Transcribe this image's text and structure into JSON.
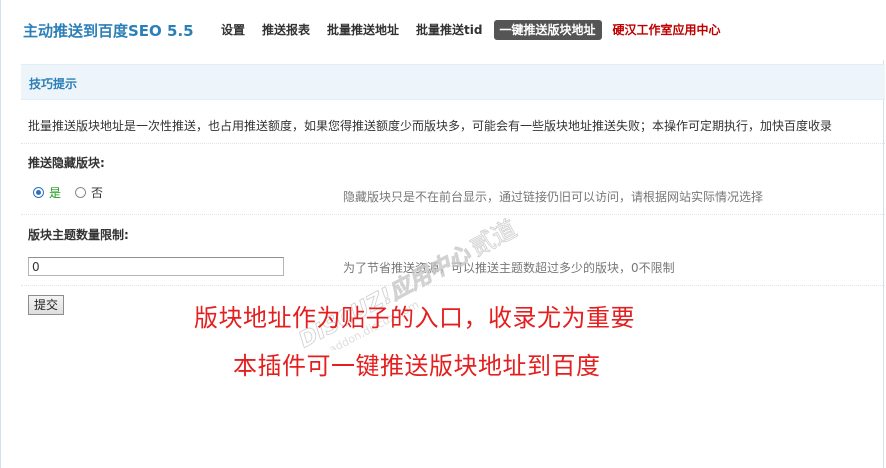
{
  "header": {
    "app_title": "主动推送到百度SEO 5.5",
    "nav": [
      {
        "label": "设置",
        "active": false,
        "external": false
      },
      {
        "label": "推送报表",
        "active": false,
        "external": false
      },
      {
        "label": "批量推送地址",
        "active": false,
        "external": false
      },
      {
        "label": "批量推送tid",
        "active": false,
        "external": false
      },
      {
        "label": "一键推送版块地址",
        "active": true,
        "external": false
      },
      {
        "label": "硬汉工作室应用中心",
        "active": false,
        "external": true
      }
    ]
  },
  "tip": {
    "title": "技巧提示",
    "text": "批量推送版块地址是一次性推送，也占用推送额度，如果您得推送额度少而版块多，可能会有一些版块地址推送失败；本操作可定期执行，加快百度收录"
  },
  "options": {
    "hidden_forums": {
      "label": "推送隐藏版块:",
      "yes_label": "是",
      "no_label": "否",
      "selected": "是",
      "hint": "隐藏版块只是不在前台显示，通过链接仍旧可以访问，请根据网站实际情况选择"
    },
    "thread_limit": {
      "label": "版块主题数量限制:",
      "value": "0",
      "hint": "为了节省推送资源，可以推送主题数超过多少的版块，0不限制"
    }
  },
  "submit_label": "提交",
  "promo": {
    "line1": "版块地址作为贴子的入口，收录尤为重要",
    "line2": "本插件可一键推送版块地址到百度"
  },
  "watermark": {
    "brand": "DISCUZ!应用中心",
    "sub": "addon.discuz.com",
    "mark": "贰道"
  },
  "colors": {
    "title_blue": "#2b7fb8",
    "active_tab_bg": "#555555",
    "external_link": "#c00000",
    "promo_red": "#e41f1f",
    "tip_bg": "#eef5fa"
  }
}
